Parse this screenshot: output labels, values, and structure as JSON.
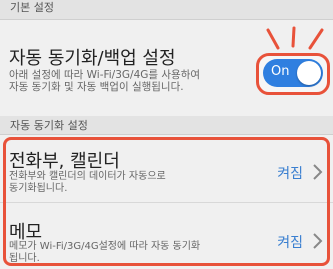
{
  "section1": {
    "header": "기본 설정"
  },
  "sync_backup": {
    "title": "자동 동기화/백업 설정",
    "description_line1": "아래 설정에 따라 Wi-Fi/3G/4G를 사용하여",
    "description_line2": "자동 동기화 및 자동 백업이 실행됩니다.",
    "toggle_label": "On",
    "toggle_on": true
  },
  "section2": {
    "header": "자동 동기화 설정"
  },
  "items": [
    {
      "title": "전화부, 캘린더",
      "description_line1": "전화부와 캘린더의 데이터가 자동으로",
      "description_line2": "동기화됩니다.",
      "status": "켜짐",
      "icon": "chevron-right-icon"
    },
    {
      "title": "메모",
      "description_line1": "메모가 Wi-Fi/3G/4G설정에 따라 자동 동기화",
      "description_line2": "됩니다.",
      "status": "켜짐",
      "icon": "chevron-right-icon"
    }
  ],
  "colors": {
    "highlight": "#e8523a",
    "toggle_on": "#2f7fe0",
    "status_text": "#3a7fd0"
  }
}
